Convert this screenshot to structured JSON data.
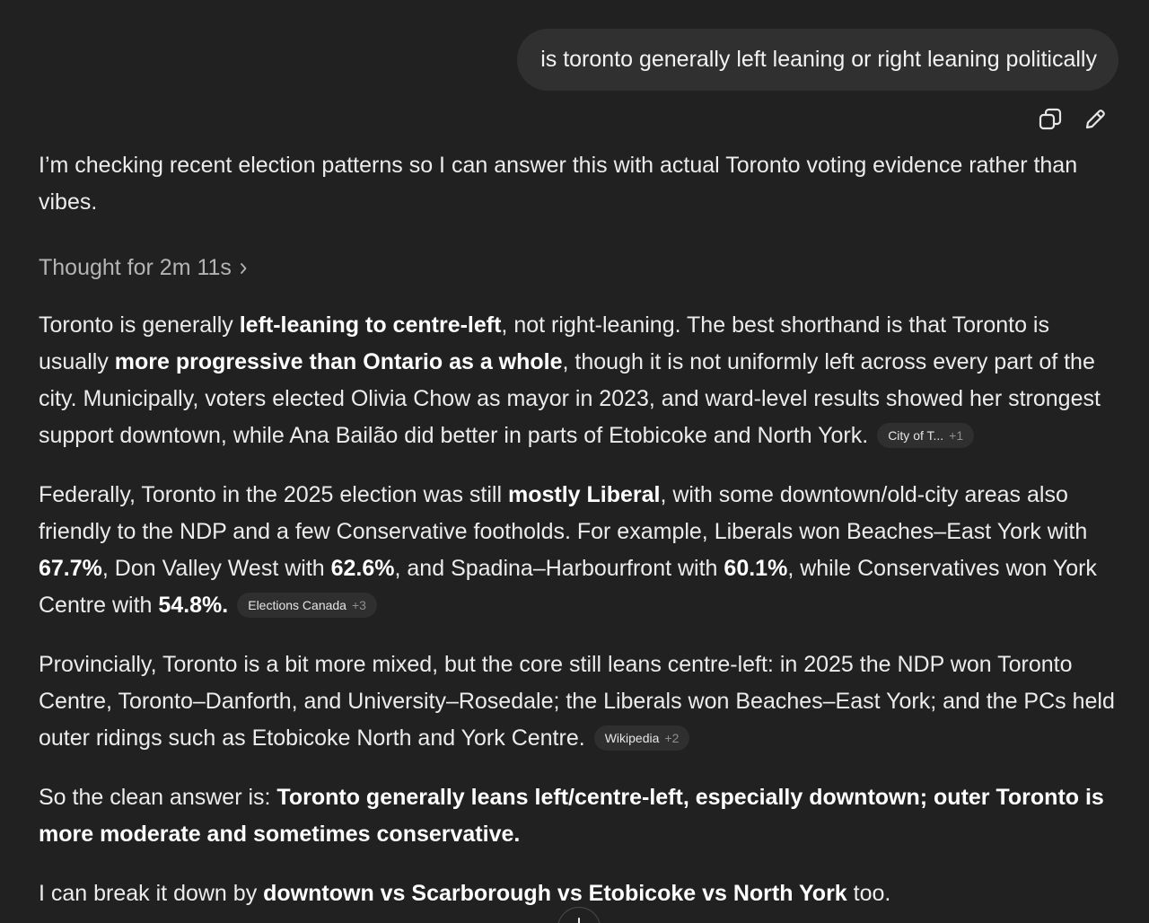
{
  "user_message": {
    "text": "is toronto generally left leaning or right leaning politically"
  },
  "message_actions": {
    "copy_icon": "copy-icon",
    "edit_icon": "pencil-icon"
  },
  "assistant": {
    "intro": "I’m checking recent election patterns so I can answer this with actual Toronto voting evidence rather than vibes.",
    "thought_label": "Thought for 2m 11s",
    "paragraphs": {
      "p1": {
        "t1": "Toronto is generally ",
        "b1": "left-leaning to centre-left",
        "t2": ", not right-leaning. The best shorthand is that Toronto is usually ",
        "b2": "more progressive than Ontario as a whole",
        "t3": ", though it is not uniformly left across every part of the city. Municipally, voters elected Olivia Chow as mayor in 2023, and ward-level results showed her strongest support downtown, while Ana Bailão did better in parts of Etobicoke and North York.",
        "cite_source": "City of T...",
        "cite_more": "+1"
      },
      "p2": {
        "t1": "Federally, Toronto in the 2025 election was still ",
        "b1": "mostly Liberal",
        "t2": ", with some downtown/old-city areas also friendly to the NDP and a few Conservative footholds. For example, Liberals won Beaches–East York with ",
        "b2": "67.7%",
        "t3": ", Don Valley West with ",
        "b3": "62.6%",
        "t4": ", and Spadina–Harbourfront with ",
        "b4": "60.1%",
        "t5": ", while Conservatives won York Centre with ",
        "b5": "54.8%.",
        "cite_source": "Elections Canada",
        "cite_more": "+3"
      },
      "p3": {
        "t1": "Provincially, Toronto is a bit more mixed, but the core still leans centre-left: in 2025 the NDP won Toronto Centre, Toronto–Danforth, and University–Rosedale; the Liberals won Beaches–East York; and the PCs held outer ridings such as Etobicoke North and York Centre.",
        "cite_source": "Wikipedia",
        "cite_more": "+2"
      },
      "p4": {
        "t1": "So the clean answer is: ",
        "b1": "Toronto generally leans left/centre-left, especially downtown; outer Toronto is more moderate and sometimes conservative."
      },
      "p5": {
        "t1": "I can break it down by ",
        "b1": "downtown vs Scarborough vs Etobicoke vs North York",
        "t2": " too."
      }
    }
  },
  "scroll_button": {
    "icon": "arrow-down-icon"
  }
}
